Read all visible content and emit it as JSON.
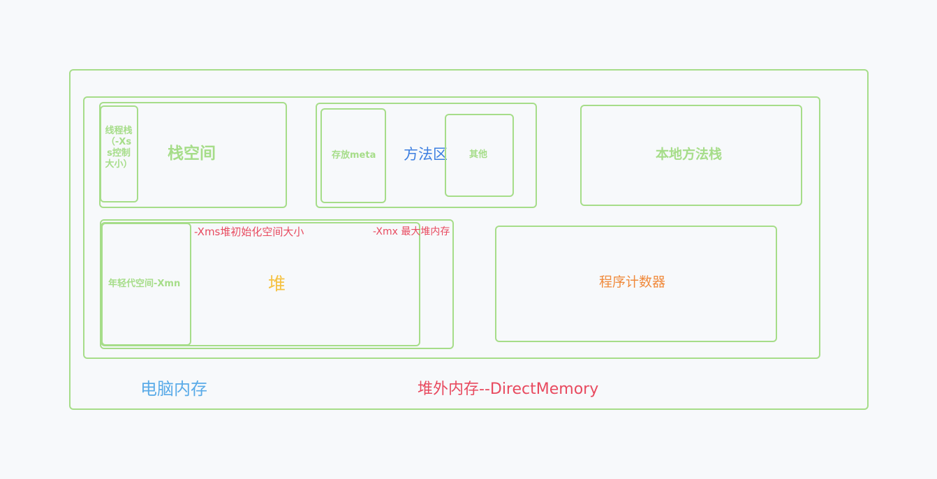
{
  "labels": {
    "computer_memory": "电脑内存",
    "offheap_memory": "堆外内存--DirectMemory",
    "stack_space": "栈空间",
    "thread_stack": "线程栈（-Xss控制大小）",
    "method_area": "方法区",
    "store_meta": "存放meta",
    "other": "其他",
    "native_method_stack": "本地方法栈",
    "xms_note": "-Xms堆初始化空间大小",
    "xmx_note": "-Xmx 最大堆内存",
    "young_gen": "年轻代空间-Xmn",
    "heap": "堆",
    "program_counter": "程序计数器"
  },
  "colors": {
    "box_border": "#a6dd89",
    "green_text": "#a6dd89",
    "blue_text": "#5aabe8",
    "method_area_text": "#3d7fe0",
    "red_text": "#e84a5f",
    "orange_text": "#f08a3c",
    "yellow_text": "#f5c242",
    "background": "#f7f9fb"
  }
}
